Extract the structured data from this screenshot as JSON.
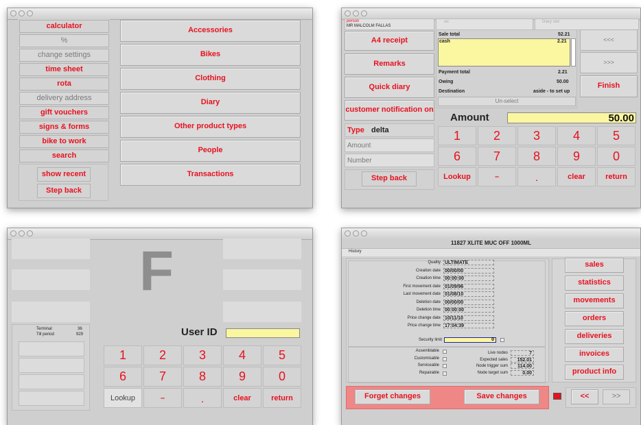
{
  "w1": {
    "left_buttons": [
      "calculator",
      "%",
      "change settings",
      "time sheet",
      "rota",
      "delivery address",
      "gift vouchers",
      "signs & forms",
      "bike to work",
      "search"
    ],
    "bottom_buttons": [
      "show recent",
      "Step back"
    ],
    "categories": [
      "Accessories",
      "Bikes",
      "Clothing",
      "Diary",
      "Other product types",
      "People",
      "Transactions"
    ]
  },
  "w2": {
    "person_label": "person",
    "person_name": "MR MALCOLM FALLAS",
    "hdr_mid": ".ec",
    "hdr_right": "Diary slot",
    "left_buttons": [
      "A4 receipt",
      "Remarks",
      "Quick diary",
      "customer notification on"
    ],
    "sale_total_label": "Sale total",
    "sale_total": "52.21",
    "cash_label": "cash",
    "cash_value": "2.21",
    "payment_total_label": "Payment total",
    "payment_total": "2.21",
    "owing_label": "Owing",
    "owing": "50.00",
    "destination_label": "Destination",
    "destination": "aside - to set up",
    "unselect": "Un-select",
    "nav_back": "<<<",
    "nav_fwd": ">>>",
    "finish": "Finish",
    "type_label": "Type",
    "type_value": "delta",
    "amount_field": "Amount",
    "number_field": "Number",
    "step_back": "Step back",
    "amount_label": "Amount",
    "amount_value": "50.00",
    "keys_row1": [
      "1",
      "2",
      "3",
      "4",
      "5"
    ],
    "keys_row2": [
      "6",
      "7",
      "8",
      "9",
      "0"
    ],
    "keys_row3": [
      "Lookup",
      "–",
      ".",
      "clear",
      "return"
    ]
  },
  "w3": {
    "big_letter": "F",
    "terminal_label": "Terminal",
    "terminal_value": "36",
    "till_label": "Till period",
    "till_value": "929",
    "user_id_label": "User ID",
    "keys_row1": [
      "1",
      "2",
      "3",
      "4",
      "5"
    ],
    "keys_row2": [
      "6",
      "7",
      "8",
      "9",
      "0"
    ],
    "keys_row3": [
      "Lookup",
      "–",
      ".",
      "clear",
      "return"
    ]
  },
  "w4": {
    "title": "11827 XLITE MUC OFF 1000ML",
    "menu_history": "History",
    "fields": [
      {
        "label": "Quality",
        "value": "ULTIMATE"
      },
      {
        "label": "Creation date",
        "value": "00/00/00"
      },
      {
        "label": "Creation time",
        "value": "00:00:00"
      },
      {
        "label": "First movement date",
        "value": "01/09/96"
      },
      {
        "label": "Last movement date",
        "value": "01/08/10"
      },
      {
        "label": "Deletion date",
        "value": "00/00/00"
      },
      {
        "label": "Deletion time",
        "value": "00:00:00"
      },
      {
        "label": "Price change date",
        "value": "10/11/10"
      },
      {
        "label": "Price change time",
        "value": "17:04:39"
      }
    ],
    "security_limit_label": "Security limit",
    "security_limit": "0",
    "checks": [
      "Assemblable",
      "Customisable",
      "Serviceable",
      "Repairable"
    ],
    "stats": [
      {
        "label": "Live nodes",
        "value": "7"
      },
      {
        "label": "Expected sales",
        "value": "152.01"
      },
      {
        "label": "Node trigger sum",
        "value": "114.00"
      },
      {
        "label": "Node target sum",
        "value": "0.00"
      }
    ],
    "right_buttons": [
      "sales",
      "statistics",
      "movements",
      "orders",
      "deliveries",
      "invoices",
      "product info"
    ],
    "forget": "Forget changes",
    "save": "Save changes",
    "prev": "<<",
    "next": ">>"
  }
}
